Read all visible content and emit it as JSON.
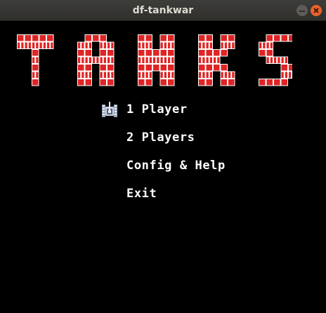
{
  "window": {
    "title": "df-tankwar"
  },
  "game": {
    "logo_text": "TANKS",
    "colors": {
      "background": "#000000",
      "brick": "#e02424",
      "mortar": "#ffffff",
      "menu_text": "#ffffff",
      "cursor_tank": "#c8d0e0"
    },
    "cursor_icon": "tank-cursor-icon",
    "selected_index": 0,
    "menu": [
      {
        "label": "1 Player"
      },
      {
        "label": "2 Players"
      },
      {
        "label": "Config & Help"
      },
      {
        "label": "Exit"
      }
    ]
  }
}
